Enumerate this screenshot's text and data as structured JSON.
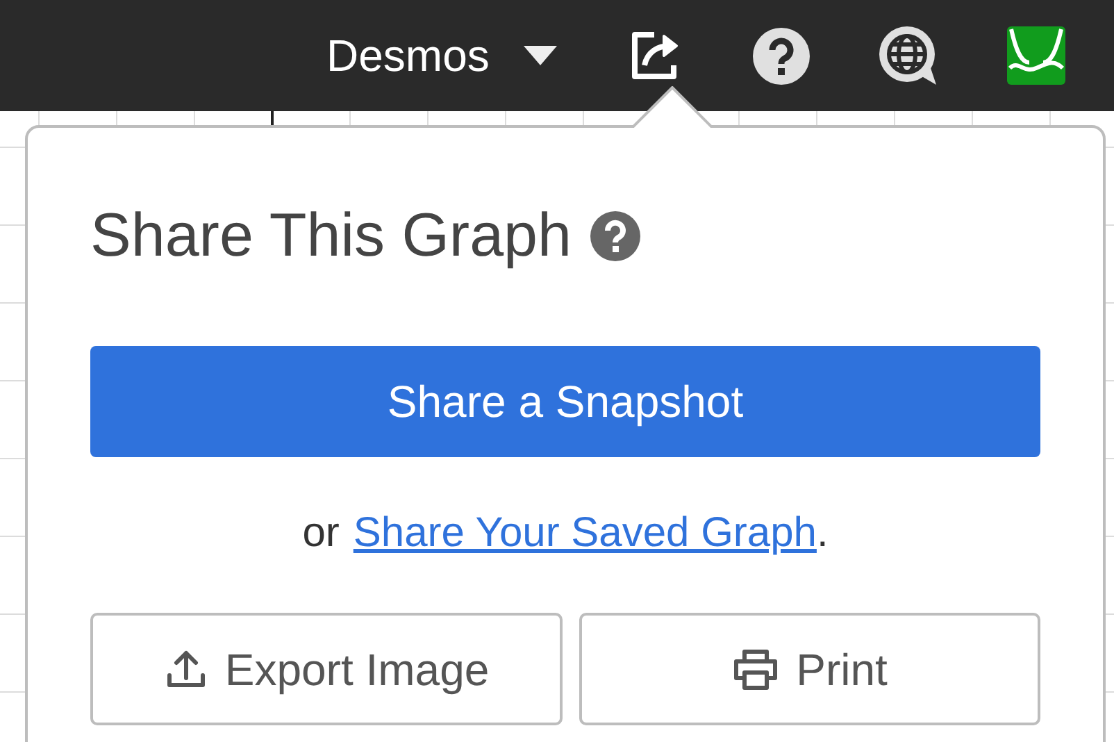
{
  "header": {
    "title": "Desmos"
  },
  "share_popover": {
    "title": "Share This Graph",
    "snapshot_button": "Share a Snapshot",
    "saved_prefix": "or",
    "saved_link": "Share Your Saved Graph",
    "saved_suffix": ".",
    "buttons": [
      {
        "kind": "export",
        "label": "Export Image"
      },
      {
        "kind": "print",
        "label": "Print"
      }
    ]
  }
}
